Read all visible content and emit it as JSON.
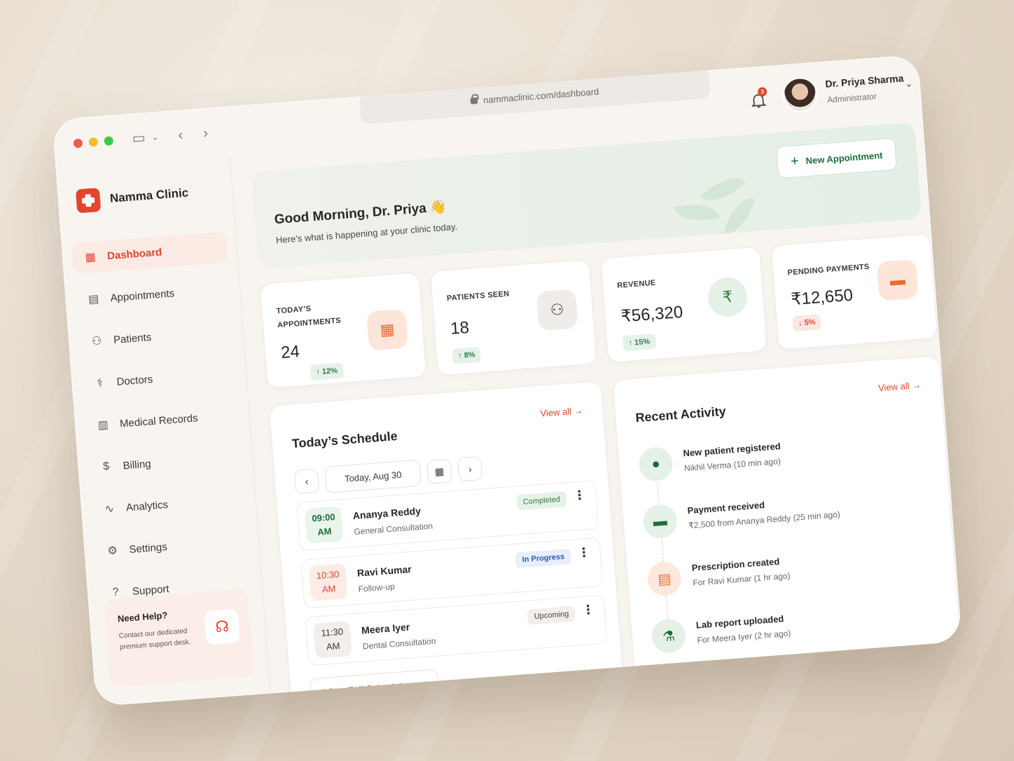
{
  "browser": {
    "url": "nammaclinic.com/dashboard"
  },
  "user": {
    "name": "Dr. Priya Sharma",
    "role": "Administrator",
    "notifications": "3"
  },
  "brand": {
    "name": "Namma Clinic"
  },
  "sidebar": {
    "items": [
      {
        "label": "Dashboard",
        "icon": "dashboard-icon"
      },
      {
        "label": "Appointments",
        "icon": "calendar-icon"
      },
      {
        "label": "Patients",
        "icon": "users-icon"
      },
      {
        "label": "Doctors",
        "icon": "stethoscope-icon"
      },
      {
        "label": "Medical Records",
        "icon": "book-icon"
      },
      {
        "label": "Billing",
        "icon": "dollar-icon"
      },
      {
        "label": "Analytics",
        "icon": "pulse-icon"
      },
      {
        "label": "Settings",
        "icon": "gear-icon"
      },
      {
        "label": "Support",
        "icon": "help-icon"
      }
    ],
    "help": {
      "title": "Need Help?",
      "text": "Contact our dedicated premium support desk."
    }
  },
  "hero": {
    "greeting": "Good Morning, Dr. Priya 👋",
    "subtitle": "Here’s what is happening at your clinic today.",
    "new_button": "New Appointment"
  },
  "stats": [
    {
      "label": "Today’s Appointments",
      "value": "24",
      "change": "↑ 12%",
      "trend": "up",
      "icon": "calendar-icon"
    },
    {
      "label": "Patients Seen",
      "value": "18",
      "change": "↑ 8%",
      "trend": "up",
      "icon": "users-icon"
    },
    {
      "label": "Revenue",
      "value": "₹56,320",
      "change": "↑ 15%",
      "trend": "up",
      "icon": "rupee-icon"
    },
    {
      "label": "Pending Payments",
      "value": "₹12,650",
      "change": "↓ 5%",
      "trend": "down",
      "icon": "wallet-icon"
    }
  ],
  "schedule": {
    "title": "Today’s Schedule",
    "view_all": "View all",
    "date": "Today, Aug 30",
    "items": [
      {
        "time_h": "09:00",
        "time_p": "AM",
        "name": "Ananya Reddy",
        "type": "General Consultation",
        "status": "Completed"
      },
      {
        "time_h": "10:30",
        "time_p": "AM",
        "name": "Ravi Kumar",
        "type": "Follow-up",
        "status": "In Progress"
      },
      {
        "time_h": "11:30",
        "time_p": "AM",
        "name": "Meera Iyer",
        "type": "Dental Consultation",
        "status": "Upcoming"
      }
    ],
    "full_button": "View Full Schedule"
  },
  "activity": {
    "title": "Recent Activity",
    "view_all": "View all",
    "items": [
      {
        "title": "New patient registered",
        "sub": "Nikhil Verma (10 min ago)",
        "icon": "user-icon"
      },
      {
        "title": "Payment received",
        "sub": "₹2,500 from Ananya Reddy (25 min ago)",
        "icon": "wallet-icon"
      },
      {
        "title": "Prescription created",
        "sub": "For Ravi Kumar (1 hr ago)",
        "icon": "document-icon"
      },
      {
        "title": "Lab report uploaded",
        "sub": "For Meera Iyer (2 hr ago)",
        "icon": "flask-icon"
      }
    ]
  }
}
